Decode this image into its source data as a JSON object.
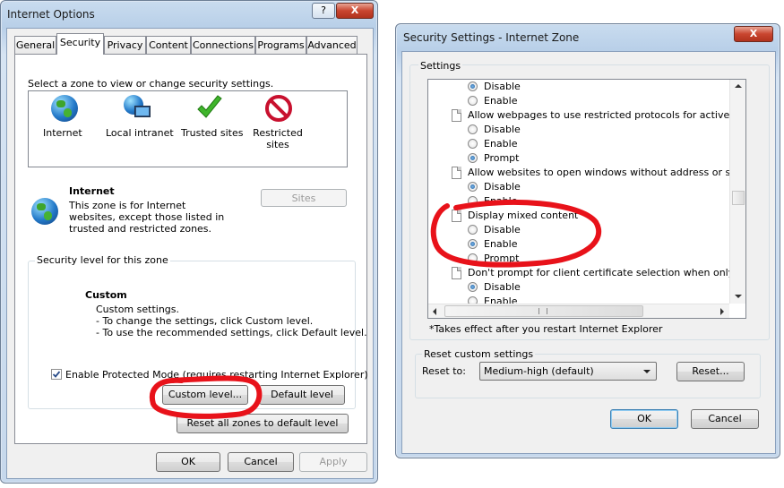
{
  "internet_options": {
    "title": "Internet Options",
    "help_btn": "?",
    "close_btn": "X",
    "tabs": [
      "General",
      "Security",
      "Privacy",
      "Content",
      "Connections",
      "Programs",
      "Advanced"
    ],
    "select_zone_text": "Select a zone to view or change security settings.",
    "zones": [
      {
        "icon": "globe-icon",
        "label": "Internet"
      },
      {
        "icon": "intranet-icon",
        "label": "Local intranet"
      },
      {
        "icon": "checkmark-icon",
        "label": "Trusted sites"
      },
      {
        "icon": "restricted-icon",
        "label": "Restricted sites"
      }
    ],
    "zone_title": "Internet",
    "zone_desc": "This zone is for Internet websites, except those listed in trusted and restricted zones.",
    "sites_button": "Sites",
    "security_level_label": "Security level for this zone",
    "custom_title": "Custom",
    "custom_lines": [
      "Custom settings.",
      "- To change the settings, click Custom level.",
      "- To use the recommended settings, click Default level."
    ],
    "protected_mode": "Enable Protected Mode (requires restarting Internet Explorer)",
    "custom_level_button": "Custom level...",
    "default_level_button": "Default level",
    "reset_all_button": "Reset all zones to default level",
    "ok": "OK",
    "cancel": "Cancel",
    "apply": "Apply"
  },
  "security_settings": {
    "title": "Security Settings - Internet Zone",
    "close_btn": "X",
    "settings_label": "Settings",
    "items": [
      {
        "type": "radio",
        "label": "Disable",
        "checked": true
      },
      {
        "type": "radio",
        "label": "Enable",
        "checked": false
      },
      {
        "type": "header",
        "label": "Allow webpages to use restricted protocols for active conten"
      },
      {
        "type": "radio",
        "label": "Disable",
        "checked": false
      },
      {
        "type": "radio",
        "label": "Enable",
        "checked": false
      },
      {
        "type": "radio",
        "label": "Prompt",
        "checked": true
      },
      {
        "type": "header",
        "label": "Allow websites to open windows without address or status ba"
      },
      {
        "type": "radio",
        "label": "Disable",
        "checked": true
      },
      {
        "type": "radio",
        "label": "Enable",
        "checked": false
      },
      {
        "type": "header",
        "label": "Display mixed content"
      },
      {
        "type": "radio",
        "label": "Disable",
        "checked": false
      },
      {
        "type": "radio",
        "label": "Enable",
        "checked": true
      },
      {
        "type": "radio",
        "label": "Prompt",
        "checked": false
      },
      {
        "type": "header",
        "label": "Don't prompt for client certificate selection when only one ce"
      },
      {
        "type": "radio",
        "label": "Disable",
        "checked": true
      },
      {
        "type": "radio",
        "label": "Enable",
        "checked": false
      }
    ],
    "restart_note": "*Takes effect after you restart Internet Explorer",
    "reset_group_label": "Reset custom settings",
    "reset_to_label": "Reset to:",
    "reset_to_value": "Medium-high (default)",
    "reset_button": "Reset...",
    "ok": "OK",
    "cancel": "Cancel"
  },
  "annotation_color": "#e8121a"
}
